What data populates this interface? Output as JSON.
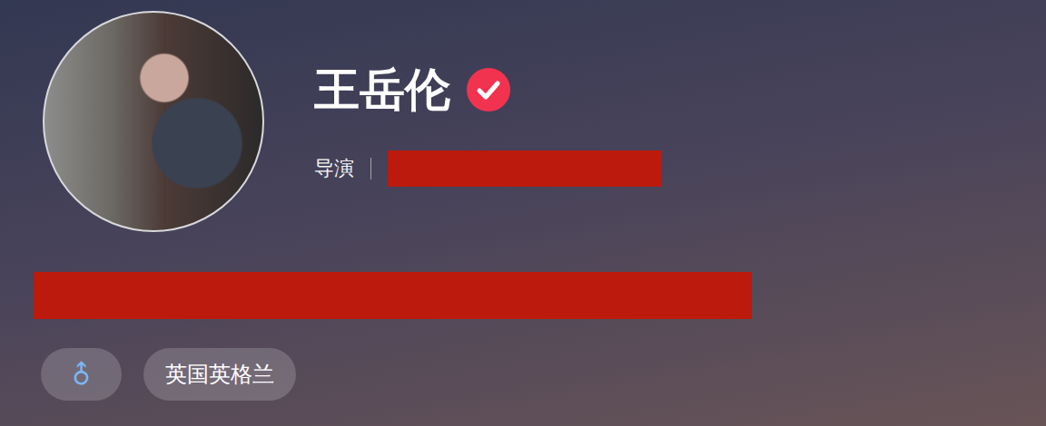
{
  "profile": {
    "name": "王岳伦",
    "verified": true,
    "role": "导演",
    "tags": [
      {
        "kind": "gender",
        "text": "♂"
      },
      {
        "kind": "location",
        "text": "英国英格兰"
      }
    ]
  }
}
